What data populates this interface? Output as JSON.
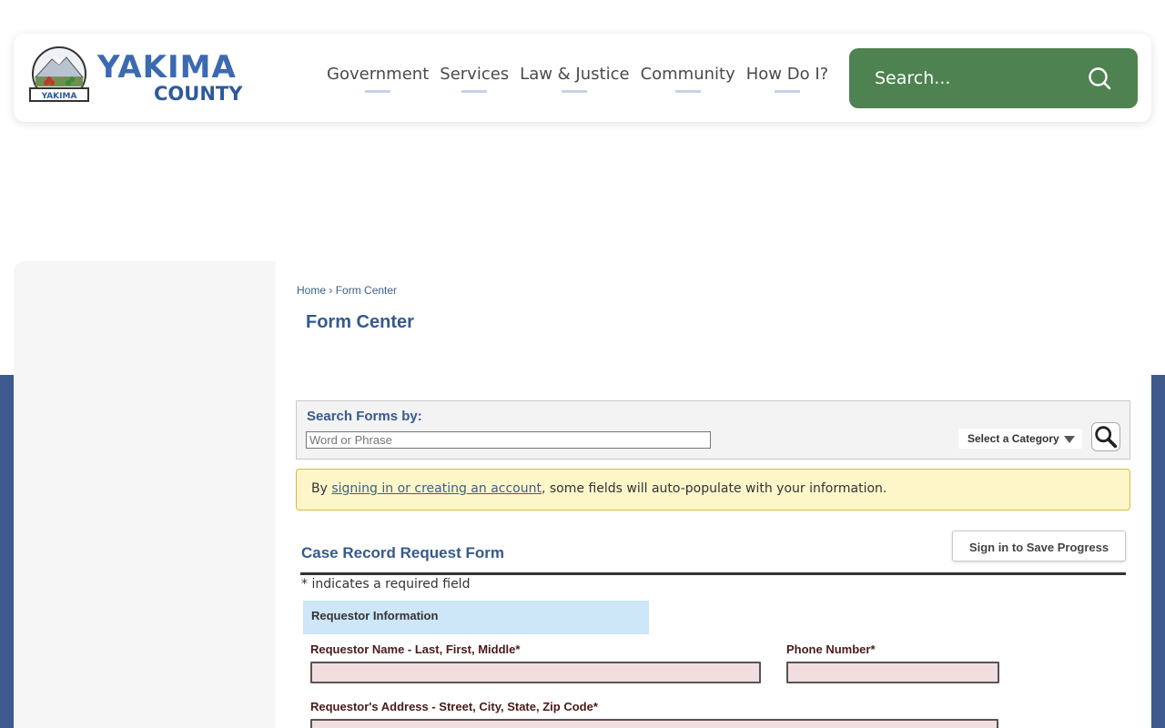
{
  "header": {
    "logo": {
      "word": "YAKIMA",
      "sub": "COUNTY",
      "seal_text": "YAKIMA"
    },
    "nav": [
      "Government",
      "Services",
      "Law & Justice",
      "Community",
      "How Do I?"
    ],
    "search": {
      "placeholder": "Search..."
    }
  },
  "breadcrumb": {
    "home": "Home",
    "separator": "›",
    "current": "Form Center"
  },
  "page_title": "Form Center",
  "search_forms": {
    "label": "Search Forms by:",
    "placeholder": "Word or Phrase",
    "category": "Select a Category"
  },
  "notice": {
    "prefix": "By ",
    "link": "signing in or creating an account",
    "suffix": ", some fields will auto-populate with your information."
  },
  "form": {
    "title": "Case Record Request Form",
    "save_label": "Sign in to Save Progress",
    "required_note": "* indicates a required field",
    "section": "Requestor Information",
    "fields": {
      "name": "Requestor Name - Last, First, Middle*",
      "phone": "Phone Number*",
      "address": "Requestor's Address - Street, City, State, Zip Code*"
    }
  },
  "colors": {
    "accent": "#365a8c",
    "search_green": "#4e8250",
    "band_blue": "#3e5a8c",
    "notice_bg": "#fdf6c9",
    "input_bg": "#f2dede"
  }
}
